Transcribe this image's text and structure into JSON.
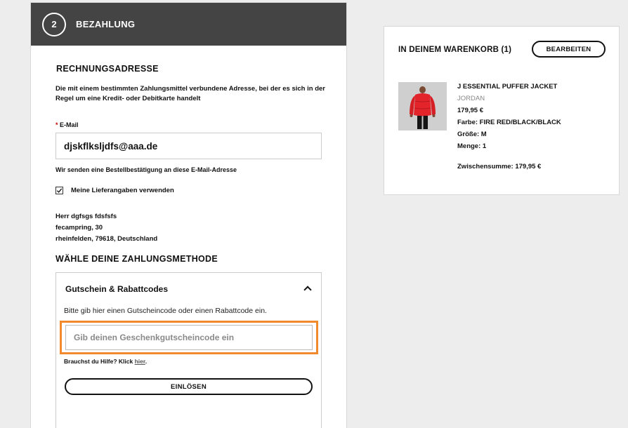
{
  "step": {
    "number": "2",
    "title": "BEZAHLUNG"
  },
  "billing": {
    "title": "RECHNUNGSADRESSE",
    "description": "Die mit einem bestimmten Zahlungsmittel verbundene Adresse, bei der es sich in der Regel um eine Kredit- oder Debitkarte handelt",
    "email_label_star": "*",
    "email_label": "E-Mail",
    "email_value": "djskflksljdfs@aaa.de",
    "email_note": "Wir senden eine Bestellbestätigung an diese E-Mail-Adresse",
    "use_shipping_label": "Meine Lieferangaben verwenden",
    "use_shipping_checked": true,
    "address": {
      "name": "Herr dgfsgs fdsfsfs",
      "street": "fecampring, 30",
      "city": "rheinfelden, 79618, Deutschland"
    }
  },
  "payment": {
    "title": "WÄHLE DEINE ZAHLUNGSMETHODE",
    "voucher": {
      "heading": "Gutschein & Rabattcodes",
      "description": "Bitte gib hier einen Gutscheincode oder einen Rabattcode ein.",
      "placeholder": "Gib deinen Geschenkgutscheincode ein",
      "help_prefix": "Brauchst du Hilfe? Klick ",
      "help_link": "hier",
      "help_suffix": ".",
      "redeem_label": "EINLÖSEN",
      "highlight_color": "#f08a2c"
    }
  },
  "cart": {
    "title": "IN DEINEM WARENKORB (1)",
    "edit_label": "BEARBEITEN",
    "item": {
      "name": "J ESSENTIAL PUFFER JACKET",
      "brand": "JORDAN",
      "price": "179,95 €",
      "color": "Farbe: FIRE RED/BLACK/BLACK",
      "size": "Größe: M",
      "quantity": "Menge: 1"
    },
    "subtotal": "Zwischensumme: 179,95 €"
  },
  "colors": {
    "header_bg": "#444444",
    "jacket_red": "#e3242b"
  }
}
